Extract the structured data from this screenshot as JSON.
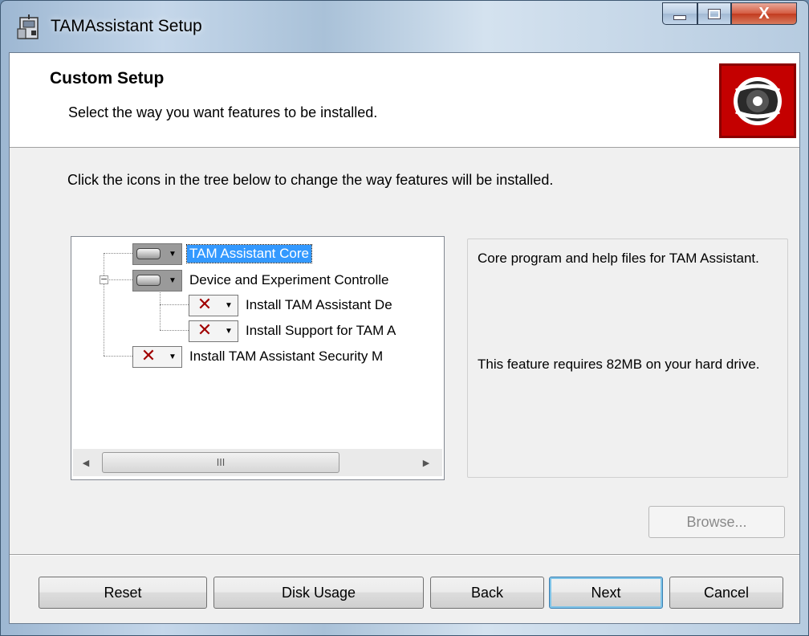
{
  "window": {
    "title": "TAMAssistant Setup",
    "close_glyph": "X"
  },
  "banner": {
    "title": "Custom Setup",
    "subtitle": "Select the way you want features to be installed.",
    "icon": "install-disc-icon",
    "icon_bg": "#c40000"
  },
  "instruction": "Click the icons in the tree below to change the way features will be installed.",
  "tree": {
    "items": [
      {
        "label": "TAM Assistant Core",
        "state": "install-local",
        "selected": true
      },
      {
        "label": "Device and Experiment Controlle",
        "state": "install-local",
        "expanded": true
      },
      {
        "label": "Install TAM Assistant De",
        "state": "not-available"
      },
      {
        "label": "Install Support for TAM A",
        "state": "not-available"
      },
      {
        "label": "Install TAM Assistant Security M",
        "state": "not-available"
      }
    ],
    "expander_glyph": "−",
    "scroll_thumb_grip": "III",
    "scroll_left": "◀",
    "scroll_right": "▶"
  },
  "description": {
    "text": "Core program and help files for TAM Assistant.",
    "requirement": "This feature requires 82MB on your hard drive."
  },
  "buttons": {
    "browse": "Browse...",
    "reset": "Reset",
    "disk_usage": "Disk Usage",
    "back": "Back",
    "next": "Next",
    "cancel": "Cancel"
  },
  "colors": {
    "selection": "#3399ff",
    "x_mark": "#a00000",
    "client_bg": "#f0f0f0"
  }
}
